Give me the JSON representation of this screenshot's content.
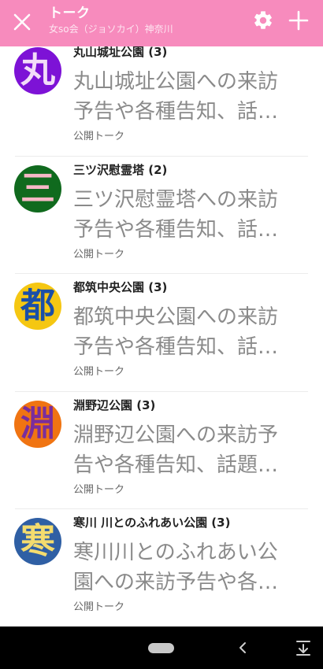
{
  "header": {
    "title": "トーク",
    "subtitle": "女so会（ジョソカイ）神奈川",
    "close_icon": "close-icon",
    "settings_icon": "gear-icon",
    "add_icon": "plus-icon",
    "background": "#f78bbd"
  },
  "chats": [
    {
      "avatar_char": "丸",
      "avatar_bg": "#7d12d6",
      "avatar_fg": "#f2dcf8",
      "title": "丸山城址公園 (3)",
      "preview": "丸山城址公園への来訪予告や各種告知、話題の共有",
      "meta": "公開トーク"
    },
    {
      "avatar_char": "三",
      "avatar_bg": "#106a1e",
      "avatar_fg": "#f6b8c6",
      "title": "三ツ沢慰霊塔 (2)",
      "preview": "三ツ沢慰霊塔への来訪予告や各種告知、話題の共有",
      "meta": "公開トーク"
    },
    {
      "avatar_char": "都",
      "avatar_bg": "#f5c712",
      "avatar_fg": "#1a4fa8",
      "title": "都筑中央公園 (3)",
      "preview": "都筑中央公園への来訪予告や各種告知、話題の共有",
      "meta": "公開トーク"
    },
    {
      "avatar_char": "淵",
      "avatar_bg": "#f07412",
      "avatar_fg": "#7a2d9c",
      "title": "淵野辺公園 (3)",
      "preview": "淵野辺公園への来訪予告や各種告知、話題の共有",
      "meta": "公開トーク"
    },
    {
      "avatar_char": "寒",
      "avatar_bg": "#2f5fa4",
      "avatar_fg": "#f4dc6e",
      "title": "寒川 川とのふれあい公園 (3)",
      "preview": "寒川川とのふれあい公園への来訪予告や各種告知",
      "meta": "公開トーク"
    }
  ],
  "navigation": {
    "home_icon": "home-pill-icon",
    "back_icon": "back-icon",
    "notification_icon": "expand-down-icon"
  }
}
